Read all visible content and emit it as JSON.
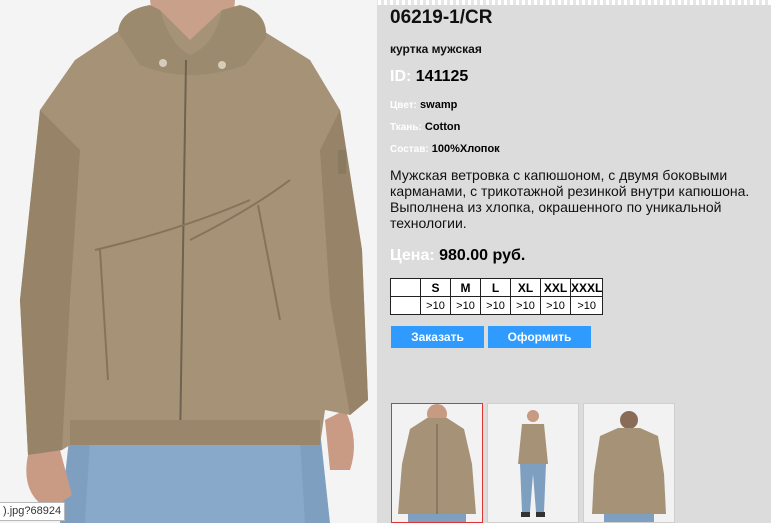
{
  "product": {
    "article": "06219-1/CR",
    "subtitle": "куртка мужская",
    "id_label": "ID:",
    "id_value": "141125",
    "color_label": "Цвет:",
    "color_value": "swamp",
    "fabric_label": "Ткань:",
    "fabric_value": "Cotton",
    "composition_label": "Состав:",
    "composition_value": "100%Хлопок",
    "description": "Мужская ветровка с капюшоном, с двумя боковыми карманами, с трикотажной резинкой внутри капюшона. Выполнена из  хлопка, окрашенного по уникальной технологии.",
    "price_label": "Цена:",
    "price_value": "980.00 руб."
  },
  "sizes": {
    "headers": [
      "S",
      "M",
      "L",
      "XL",
      "XXL",
      "XXXL"
    ],
    "stock": [
      ">10",
      ">10",
      ">10",
      ">10",
      ">10",
      ">10"
    ]
  },
  "buttons": {
    "order": "Заказать",
    "checkout": "Оформить"
  },
  "status_bar": {
    "url": ").jpg?68924"
  },
  "colors": {
    "jacket": "#a69377",
    "button": "#2f9bff",
    "page_bg": "#dcdcdc",
    "selected_border": "#dd3333"
  }
}
